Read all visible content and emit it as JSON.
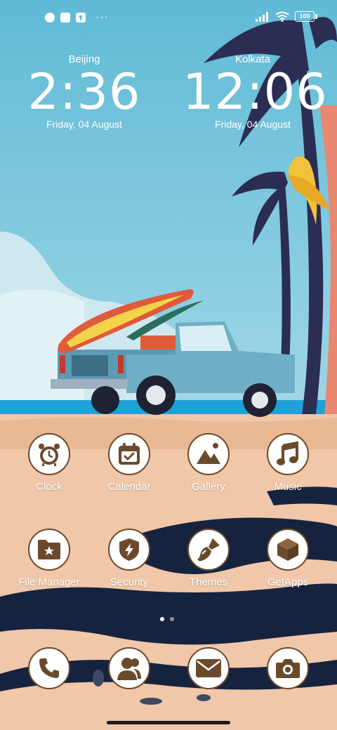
{
  "status_bar": {
    "left_icons": [
      "notification-icon",
      "square-app-icon",
      "upload-icon"
    ],
    "more": "···",
    "battery": "100",
    "right_icons": [
      "signal-icon",
      "wifi-icon",
      "battery-icon"
    ]
  },
  "clocks": [
    {
      "city": "Beijing",
      "time": "2:36",
      "date": "Friday, 04 August"
    },
    {
      "city": "Kolkata",
      "time": "12:06",
      "date": "Friday, 04 August"
    }
  ],
  "apps_row1": [
    {
      "label": "Clock",
      "icon": "alarm-clock-icon"
    },
    {
      "label": "Calendar",
      "icon": "calendar-icon"
    },
    {
      "label": "Gallery",
      "icon": "gallery-icon"
    },
    {
      "label": "Music",
      "icon": "music-note-icon"
    }
  ],
  "apps_row2": [
    {
      "label": "File Manager",
      "icon": "folder-icon"
    },
    {
      "label": "Security",
      "icon": "shield-icon"
    },
    {
      "label": "Themes",
      "icon": "brush-icon"
    },
    {
      "label": "GetApps",
      "icon": "box-icon"
    }
  ],
  "dock": [
    {
      "icon": "phone-icon"
    },
    {
      "icon": "contacts-icon"
    },
    {
      "icon": "mail-icon"
    },
    {
      "icon": "camera-icon"
    }
  ],
  "page_indicator": {
    "current": 1,
    "total": 2
  },
  "colors": {
    "sky": "#7ec7dc",
    "sand": "#f0c7a8",
    "icon_brown": "#6b4a2b",
    "ocean": "#1fa1d8"
  }
}
